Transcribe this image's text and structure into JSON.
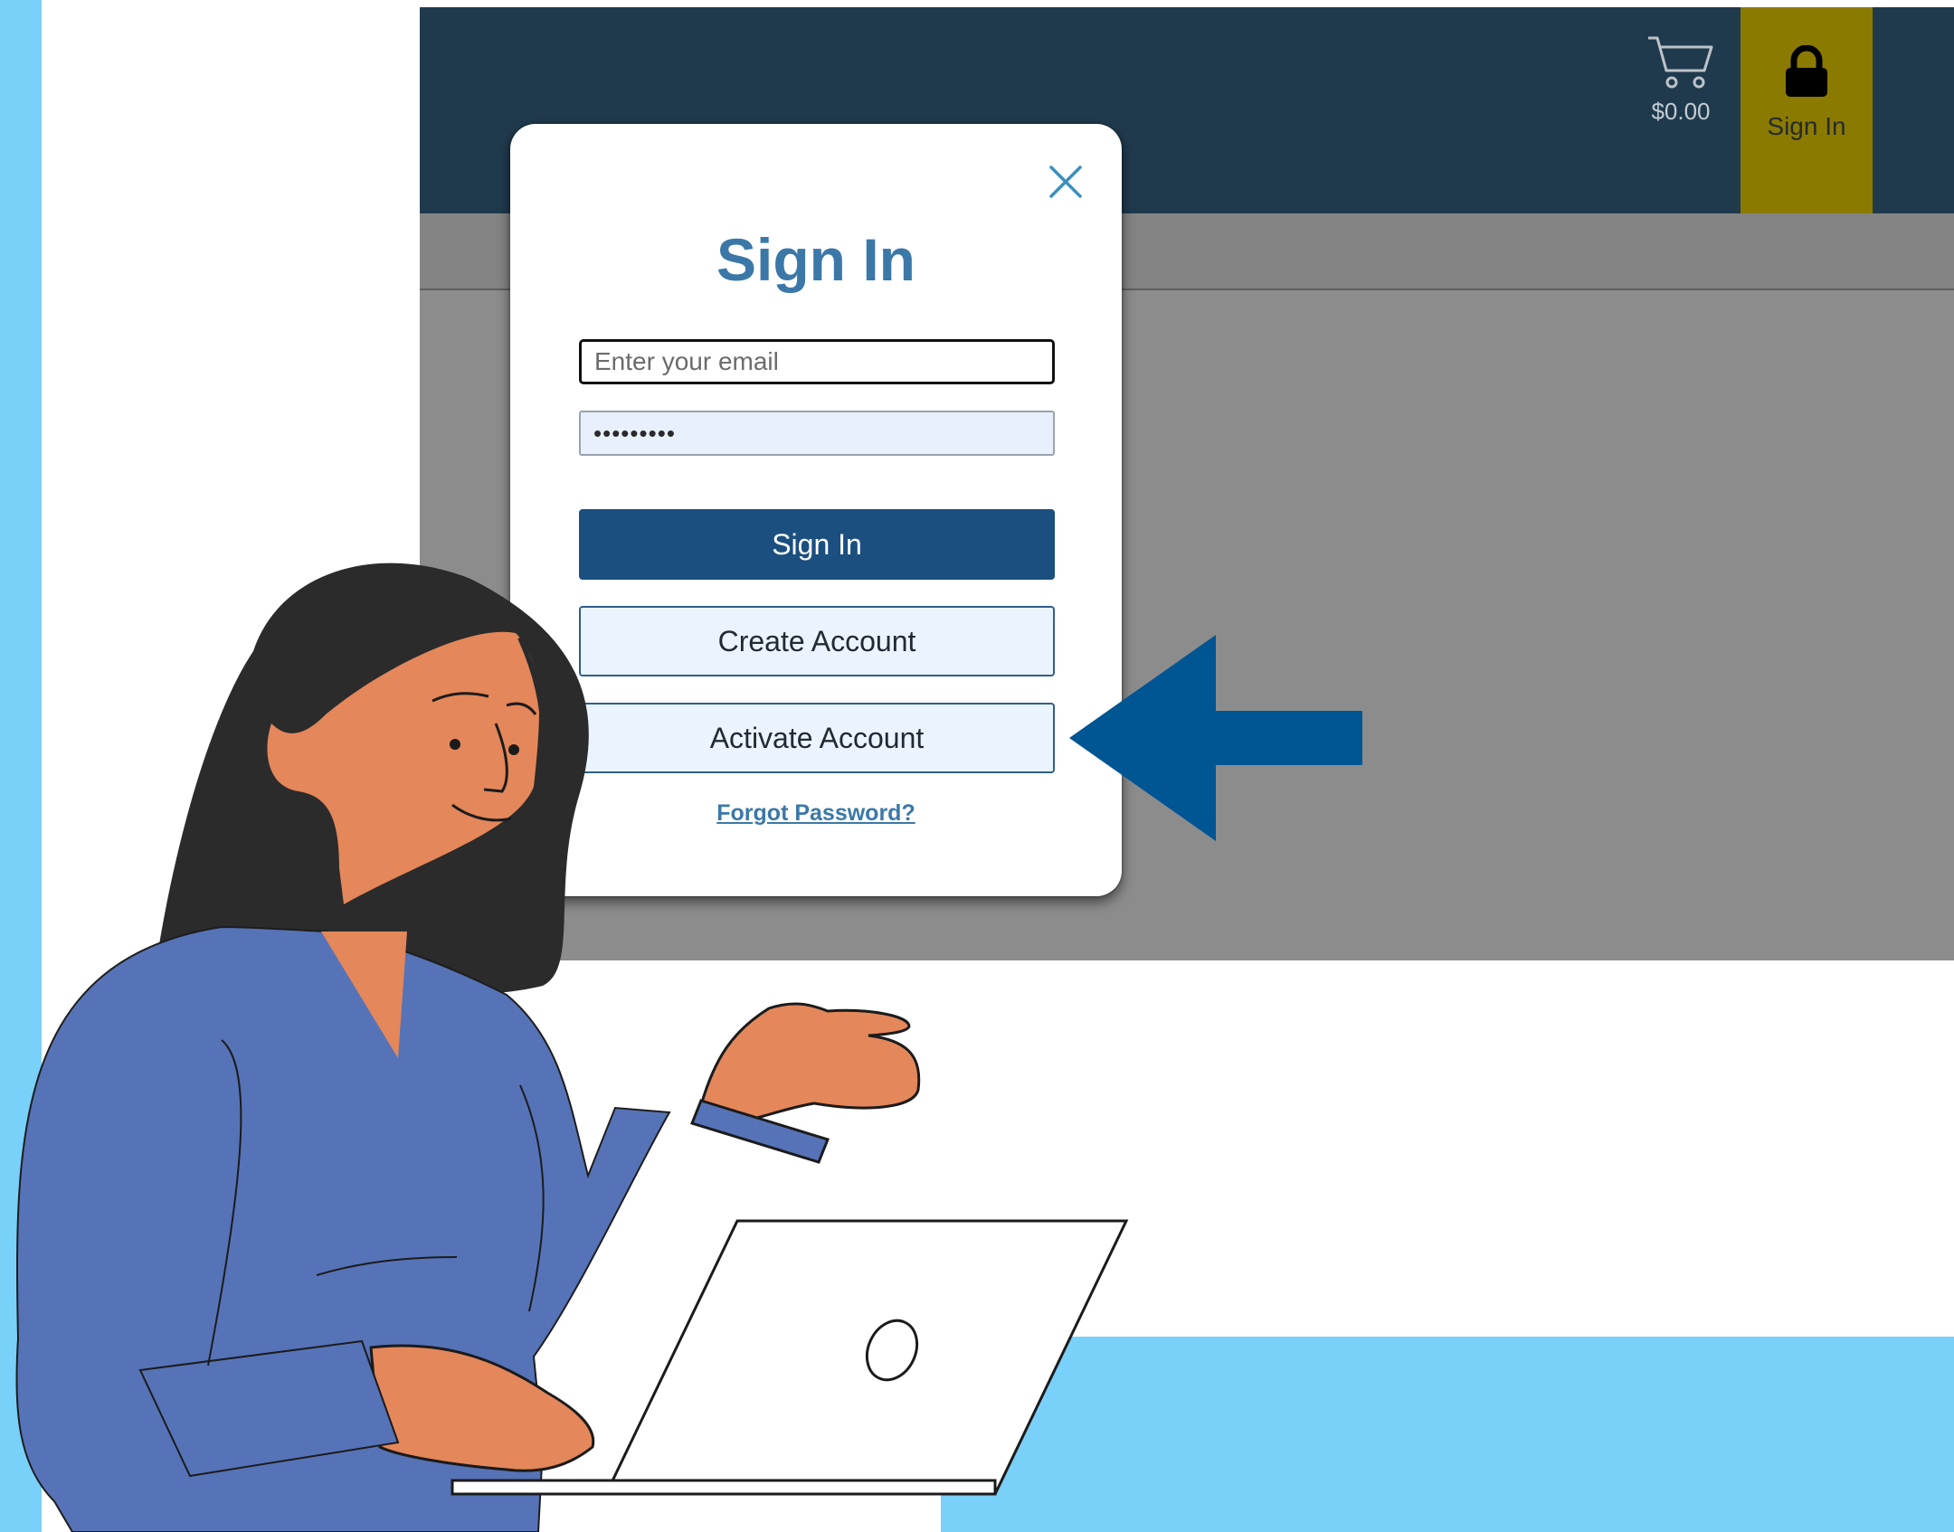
{
  "colors": {
    "header": "#203a4d",
    "accent_signin": "#8b7a00",
    "primary_button": "#1b4f7f",
    "title_blue": "#3b78a8",
    "arrow_blue": "#005593",
    "light_blue_bg": "#79d0f9"
  },
  "header": {
    "cart_icon": "cart-icon",
    "cart_total": "$0.00",
    "signin_icon": "lock-icon",
    "signin_label": "Sign In"
  },
  "modal": {
    "close_icon": "close-icon",
    "title": "Sign In",
    "email_placeholder": "Enter your email",
    "password_value": "•••••••••",
    "signin_button": "Sign In",
    "create_account_button": "Create Account",
    "activate_account_button": "Activate Account",
    "forgot_password_link": "Forgot Password?"
  },
  "annotation": {
    "arrow_icon": "left-arrow-icon"
  }
}
